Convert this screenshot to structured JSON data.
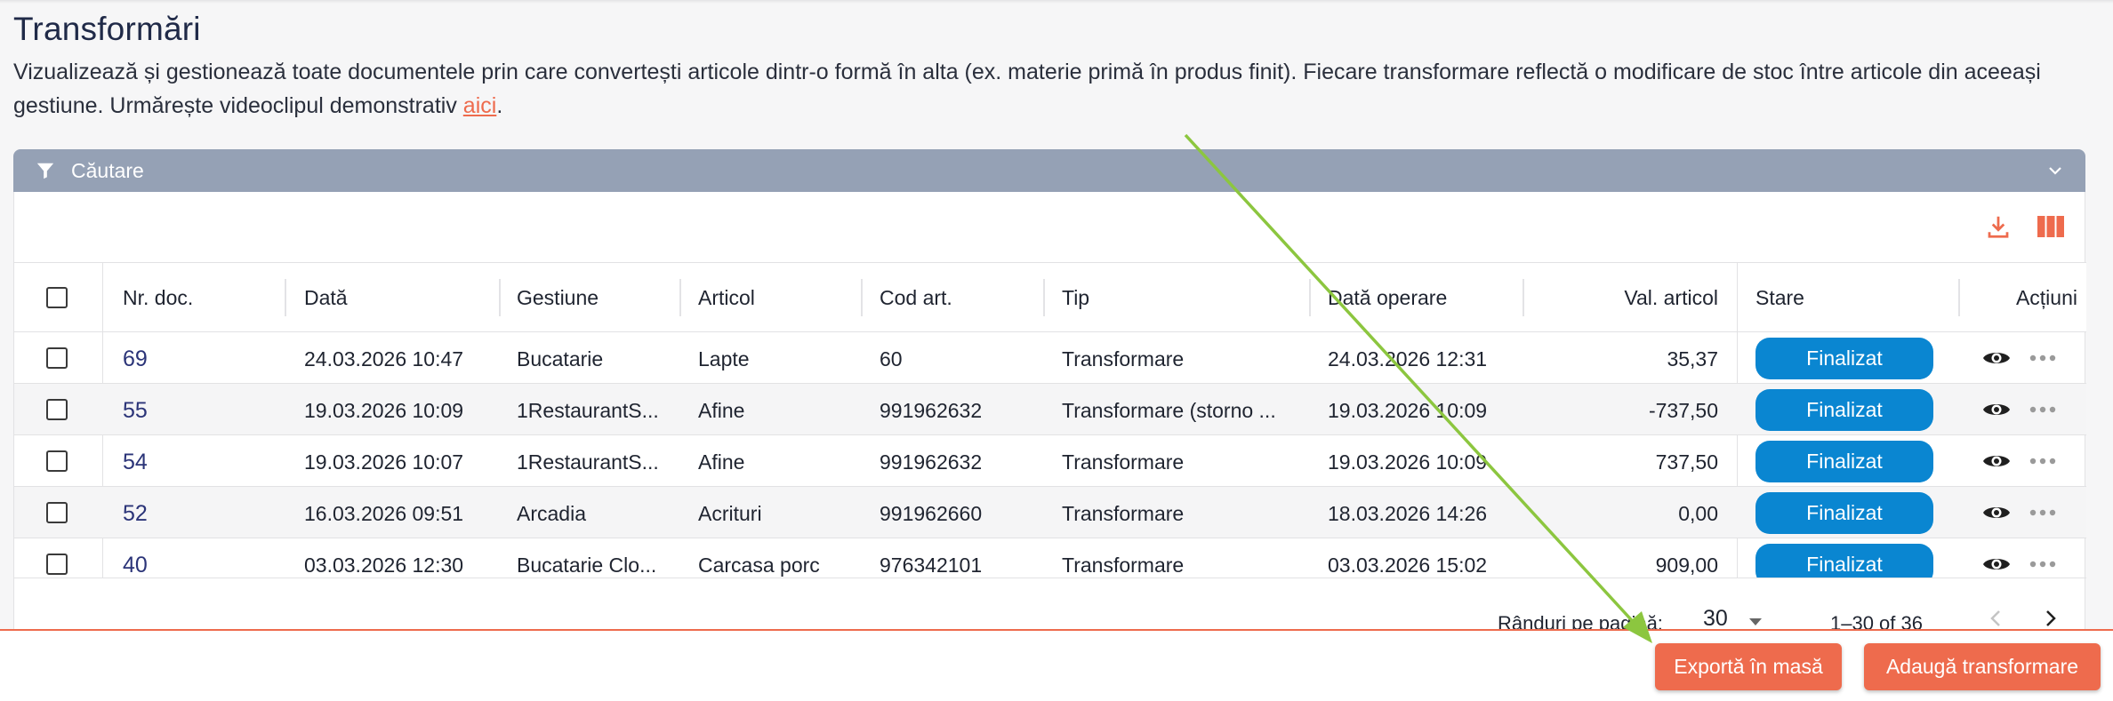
{
  "page": {
    "title": "Transformări",
    "description_text": "Vizualizează și gestionează toate documentele prin care convertești articole dintr-o formă în alta (ex. materie primă în produs finit). Fiecare transformare reflectă o modificare de stoc între articole din aceeași gestiune. Urmărește videoclipul demonstrativ ",
    "description_link": "aici",
    "description_end": "."
  },
  "search": {
    "label": "Căutare"
  },
  "toolbar": {
    "download_icon": "download-icon",
    "columns_icon": "columns-icon",
    "accent": "#ee6b4d"
  },
  "table": {
    "columns": [
      "Nr. doc.",
      "Dată",
      "Gestiune",
      "Articol",
      "Cod art.",
      "Tip",
      "Dată operare",
      "Val. articol",
      "Stare",
      "Acțiuni"
    ],
    "rows": [
      {
        "nr": "69",
        "data": "24.03.2026 10:47",
        "gestiune": "Bucatarie",
        "articol": "Lapte",
        "cod": "60",
        "tip": "Transformare",
        "data_operare": "24.03.2026 12:31",
        "val": "35,37",
        "stare": "Finalizat"
      },
      {
        "nr": "55",
        "data": "19.03.2026 10:09",
        "gestiune": "1RestaurantS...",
        "articol": "Afine",
        "cod": "991962632",
        "tip": "Transformare (storno ...",
        "data_operare": "19.03.2026 10:09",
        "val": "-737,50",
        "stare": "Finalizat"
      },
      {
        "nr": "54",
        "data": "19.03.2026 10:07",
        "gestiune": "1RestaurantS...",
        "articol": "Afine",
        "cod": "991962632",
        "tip": "Transformare",
        "data_operare": "19.03.2026 10:09",
        "val": "737,50",
        "stare": "Finalizat"
      },
      {
        "nr": "52",
        "data": "16.03.2026 09:51",
        "gestiune": "Arcadia",
        "articol": "Acrituri",
        "cod": "991962660",
        "tip": "Transformare",
        "data_operare": "18.03.2026 14:26",
        "val": "0,00",
        "stare": "Finalizat"
      },
      {
        "nr": "40",
        "data": "03.03.2026 12:30",
        "gestiune": "Bucatarie Clo...",
        "articol": "Carcasa porc",
        "cod": "976342101",
        "tip": "Transformare",
        "data_operare": "03.03.2026 15:02",
        "val": "909,00",
        "stare": "Finalizat"
      }
    ]
  },
  "pagination": {
    "rows_label": "Rânduri pe pagină:",
    "rows_value": "30",
    "range": "1–30 of 36"
  },
  "actions": {
    "export": "Exportă în masă",
    "add": "Adaugă transformare"
  },
  "colors": {
    "accent": "#ee6b4d",
    "status_blue": "#0a86d1",
    "search_bar": "#95a1b5",
    "doc_link": "#2b3478",
    "annotation_arrow": "#8cc63f"
  }
}
